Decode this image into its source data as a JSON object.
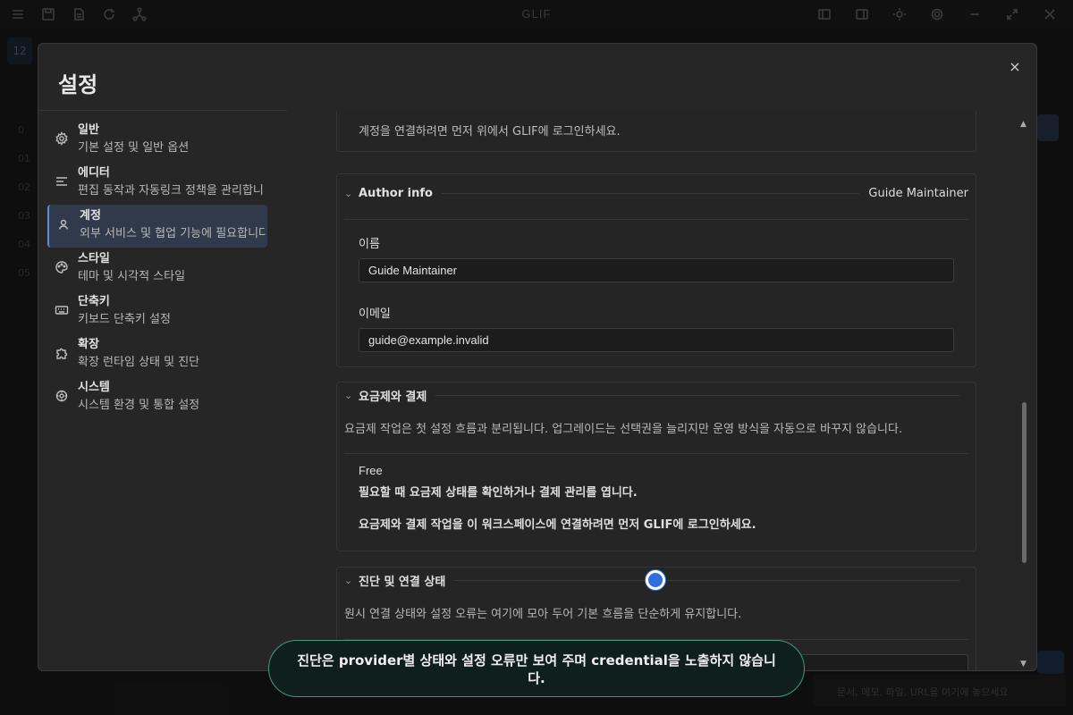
{
  "app": {
    "title": "GLIF"
  },
  "background": {
    "tab_label": "12",
    "list_items": [
      "0",
      "01",
      "02",
      "03",
      "04",
      "05"
    ],
    "bottom_input_placeholder": "문서, 메모, 파일, URL을 여기에 놓으세요"
  },
  "modal": {
    "title": "설정",
    "close_label": "×"
  },
  "nav": {
    "items": [
      {
        "label": "일반",
        "desc": "기본 설정 및 일반 옵션",
        "icon": "gear-icon"
      },
      {
        "label": "에디터",
        "desc": "편집 동작과 자동링크 정책을 관리합니",
        "icon": "text-lines-icon"
      },
      {
        "label": "계정",
        "desc": "외부 서비스 및 협업 기능에 필요합니다",
        "icon": "user-icon"
      },
      {
        "label": "스타일",
        "desc": "테마 및 시각적 스타일",
        "icon": "palette-icon"
      },
      {
        "label": "단축키",
        "desc": "키보드 단축키 설정",
        "icon": "keyboard-icon"
      },
      {
        "label": "확장",
        "desc": "확장 런타임 상태 및 진단",
        "icon": "puzzle-icon"
      },
      {
        "label": "시스템",
        "desc": "시스템 환경 및 통합 설정",
        "icon": "system-gear-icon"
      }
    ],
    "active_index": 2
  },
  "content": {
    "login_hint": "계정을 연결하려면 먼저 위에서 GLIF에 로그인하세요.",
    "author": {
      "title": "Author info",
      "summary": "Guide Maintainer",
      "name_label": "이름",
      "name_value": "Guide Maintainer",
      "email_label": "이메일",
      "email_value": "guide@example.invalid"
    },
    "billing": {
      "title": "요금제와 결제",
      "description": "요금제 작업은 첫 설정 흐름과 분리됩니다. 업그레이드는 선택권을 늘리지만 운영 방식을 자동으로 바꾸지 않습니다.",
      "plan_name": "Free",
      "plan_hint": "필요할 때 요금제 상태를 확인하거나 결제 관리를 엽니다.",
      "login_hint": "요금제와 결제 작업을 이 워크스페이스에 연결하려면 먼저 GLIF에 로그인하세요."
    },
    "diagnostics": {
      "title": "진단 및 연결 상태",
      "description": "원시 연결 상태와 설정 오류는 여기에 모아 두어 기본 흐름을 단순하게 유지합니다."
    }
  },
  "toast": {
    "message": "진단은 provider별 상태와 설정 오류만 보여 주며 credential을 노출하지 않습니다."
  }
}
